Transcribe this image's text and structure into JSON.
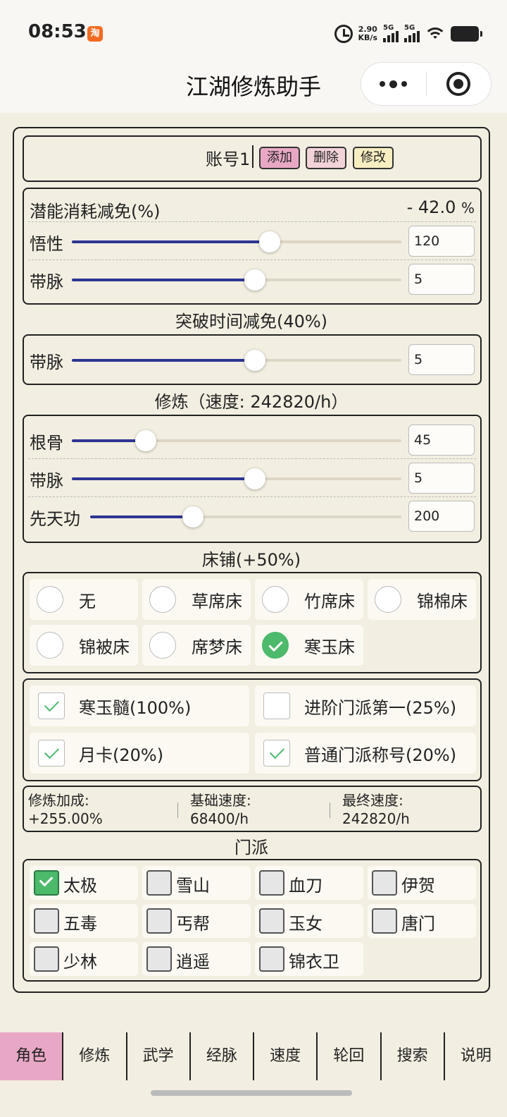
{
  "status": {
    "time": "08:53",
    "app_badge": "淘",
    "net_speed_value": "2.90",
    "net_speed_unit": "KB/s",
    "sim1": "5G",
    "sim2": "5G"
  },
  "header": {
    "title": "江湖修炼助手"
  },
  "account": {
    "name": "账号1",
    "add": "添加",
    "delete": "删除",
    "edit": "修改"
  },
  "potential": {
    "label": "潜能消耗减免(%)",
    "value": "- 42.0",
    "unit": "%",
    "rows": [
      {
        "label": "悟性",
        "value": "120",
        "level": 0.6
      },
      {
        "label": "带脉",
        "value": "5",
        "level": 0.555
      }
    ]
  },
  "breakthrough": {
    "title": "突破时间减免(40%)",
    "rows": [
      {
        "label": "带脉",
        "value": "5",
        "level": 0.555
      }
    ]
  },
  "cultivation": {
    "title": "修炼（速度: 242820/h）",
    "rows": [
      {
        "label": "根骨",
        "value": "45",
        "level": 0.225
      },
      {
        "label": "带脉",
        "value": "5",
        "level": 0.555
      },
      {
        "label": "先天功",
        "value": "200",
        "level": 0.33
      }
    ]
  },
  "bed": {
    "title": "床铺(+50%)",
    "options": [
      {
        "label": "无",
        "selected": false
      },
      {
        "label": "草席床",
        "selected": false
      },
      {
        "label": "竹席床",
        "selected": false
      },
      {
        "label": "锦棉床",
        "selected": false
      },
      {
        "label": "锦被床",
        "selected": false
      },
      {
        "label": "席梦床",
        "selected": false
      },
      {
        "label": "寒玉床",
        "selected": true
      }
    ]
  },
  "bonuses": [
    {
      "label": "寒玉髓(100%)",
      "checked": true
    },
    {
      "label": "进阶门派第一(25%)",
      "checked": false
    },
    {
      "label": "月卡(20%)",
      "checked": true
    },
    {
      "label": "普通门派称号(20%)",
      "checked": true
    }
  ],
  "summary": {
    "bonus_label": "修炼加成:",
    "bonus_value": "+255.00%",
    "base_label": "基础速度:",
    "base_value": "68400/h",
    "final_label": "最终速度:",
    "final_value": "242820/h"
  },
  "sect": {
    "title": "门派",
    "options": [
      {
        "label": "太极",
        "checked": true
      },
      {
        "label": "雪山",
        "checked": false
      },
      {
        "label": "血刀",
        "checked": false
      },
      {
        "label": "伊贺",
        "checked": false
      },
      {
        "label": "五毒",
        "checked": false
      },
      {
        "label": "丐帮",
        "checked": false
      },
      {
        "label": "玉女",
        "checked": false
      },
      {
        "label": "唐门",
        "checked": false
      },
      {
        "label": "少林",
        "checked": false
      },
      {
        "label": "逍遥",
        "checked": false
      },
      {
        "label": "锦衣卫",
        "checked": false
      }
    ]
  },
  "tabs": [
    {
      "label": "角色",
      "active": true
    },
    {
      "label": "修炼"
    },
    {
      "label": "武学"
    },
    {
      "label": "经脉"
    },
    {
      "label": "速度"
    },
    {
      "label": "轮回"
    },
    {
      "label": "搜索"
    },
    {
      "label": "说明"
    }
  ],
  "colors": {
    "accent_pink": "#e8a8c5",
    "slider_fill": "#2d3593",
    "check_green": "#4cb96b",
    "background": "#f2eee1"
  }
}
